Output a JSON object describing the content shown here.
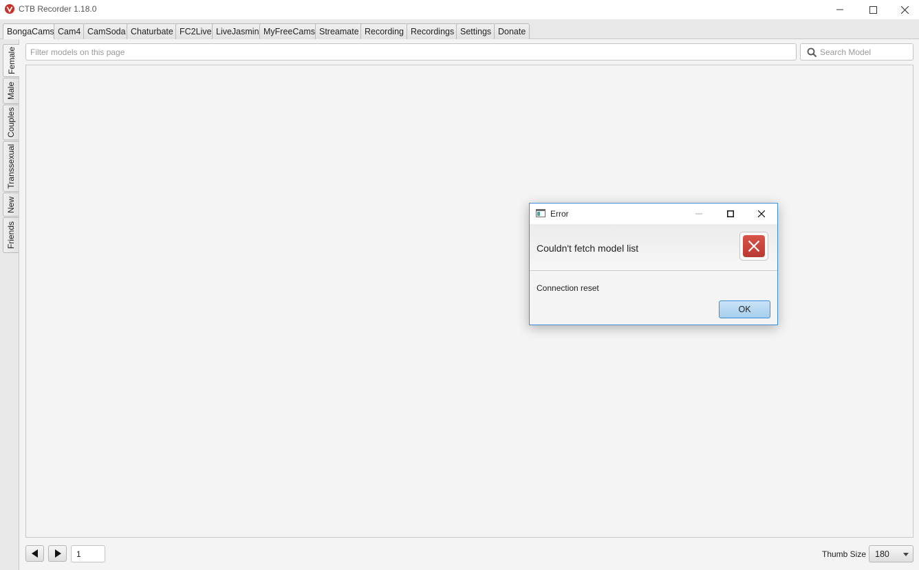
{
  "window": {
    "title": "CTB Recorder 1.18.0"
  },
  "top_tabs": [
    {
      "label": "BongaCams",
      "active": true
    },
    {
      "label": "Cam4"
    },
    {
      "label": "CamSoda"
    },
    {
      "label": "Chaturbate"
    },
    {
      "label": "FC2Live"
    },
    {
      "label": "LiveJasmin"
    },
    {
      "label": "MyFreeCams"
    },
    {
      "label": "Streamate"
    },
    {
      "label": "Recording"
    },
    {
      "label": "Recordings"
    },
    {
      "label": "Settings"
    },
    {
      "label": "Donate"
    }
  ],
  "side_tabs": [
    {
      "label": "Female",
      "active": true
    },
    {
      "label": "Male"
    },
    {
      "label": "Couples"
    },
    {
      "label": "Transsexual"
    },
    {
      "label": "New"
    },
    {
      "label": "Friends"
    }
  ],
  "filter": {
    "placeholder": "Filter models on this page"
  },
  "search": {
    "placeholder": "Search Model"
  },
  "pagination": {
    "page": "1"
  },
  "thumb": {
    "label": "Thumb Size",
    "value": "180"
  },
  "dialog": {
    "title": "Error",
    "header": "Couldn't fetch model list",
    "message": "Connection reset",
    "ok_label": "OK"
  },
  "colors": {
    "accent": "#3c8cd8",
    "error": "#c9453d"
  }
}
